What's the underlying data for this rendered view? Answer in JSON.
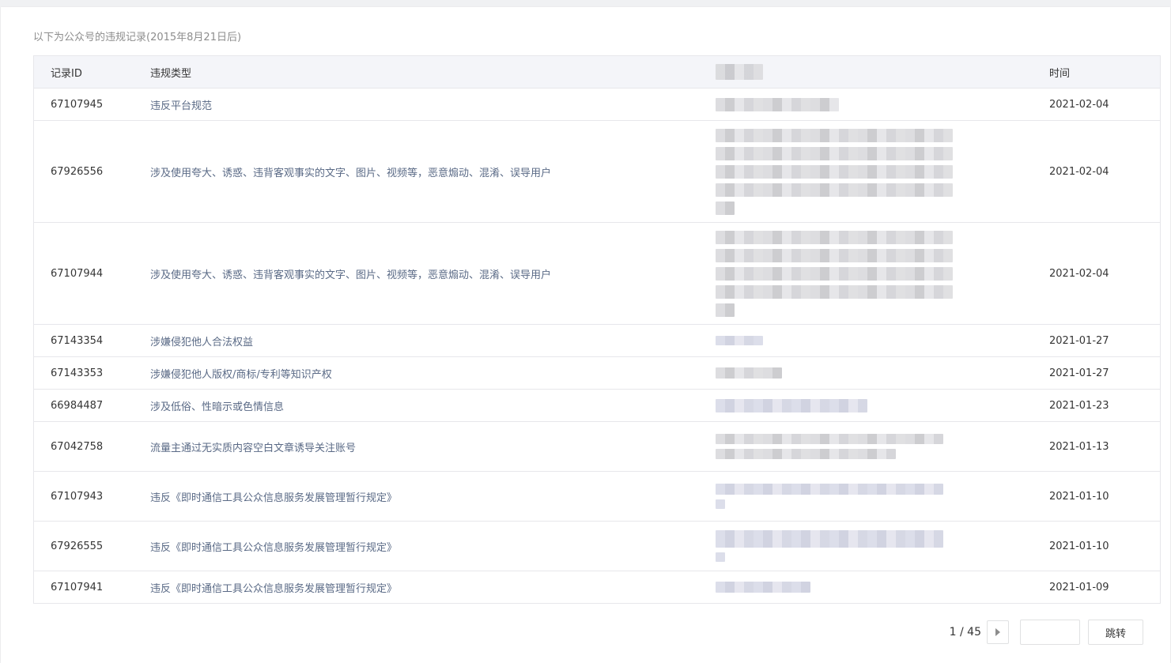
{
  "caption": "以下为公众号的违规记录(2015年8月21日后)",
  "table": {
    "headers": {
      "id": "记录ID",
      "type": "违规类型",
      "time": "时间"
    },
    "rows": [
      {
        "id": "67107945",
        "type": "违反平台规范",
        "time": "2021-02-04"
      },
      {
        "id": "67926556",
        "type": "涉及使用夸大、诱惑、违背客观事实的文字、图片、视频等，恶意煽动、混淆、误导用户",
        "time": "2021-02-04"
      },
      {
        "id": "67107944",
        "type": "涉及使用夸大、诱惑、违背客观事实的文字、图片、视频等，恶意煽动、混淆、误导用户",
        "time": "2021-02-04"
      },
      {
        "id": "67143354",
        "type": "涉嫌侵犯他人合法权益",
        "time": "2021-01-27"
      },
      {
        "id": "67143353",
        "type": "涉嫌侵犯他人版权/商标/专利等知识产权",
        "time": "2021-01-27"
      },
      {
        "id": "66984487",
        "type": "涉及低俗、性暗示或色情信息",
        "time": "2021-01-23"
      },
      {
        "id": "67042758",
        "type": "流量主通过无实质内容空白文章诱导关注账号",
        "time": "2021-01-13"
      },
      {
        "id": "67107943",
        "type": "违反《即时通信工具公众信息服务发展管理暂行规定》",
        "time": "2021-01-10"
      },
      {
        "id": "67926555",
        "type": "违反《即时通信工具公众信息服务发展管理暂行规定》",
        "time": "2021-01-10"
      },
      {
        "id": "67107941",
        "type": "违反《即时通信工具公众信息服务发展管理暂行规定》",
        "time": "2021-01-09"
      }
    ]
  },
  "pager": {
    "count": "1 / 45",
    "next_icon": "triangle-right-icon",
    "jump_label": "跳转",
    "input_value": ""
  }
}
